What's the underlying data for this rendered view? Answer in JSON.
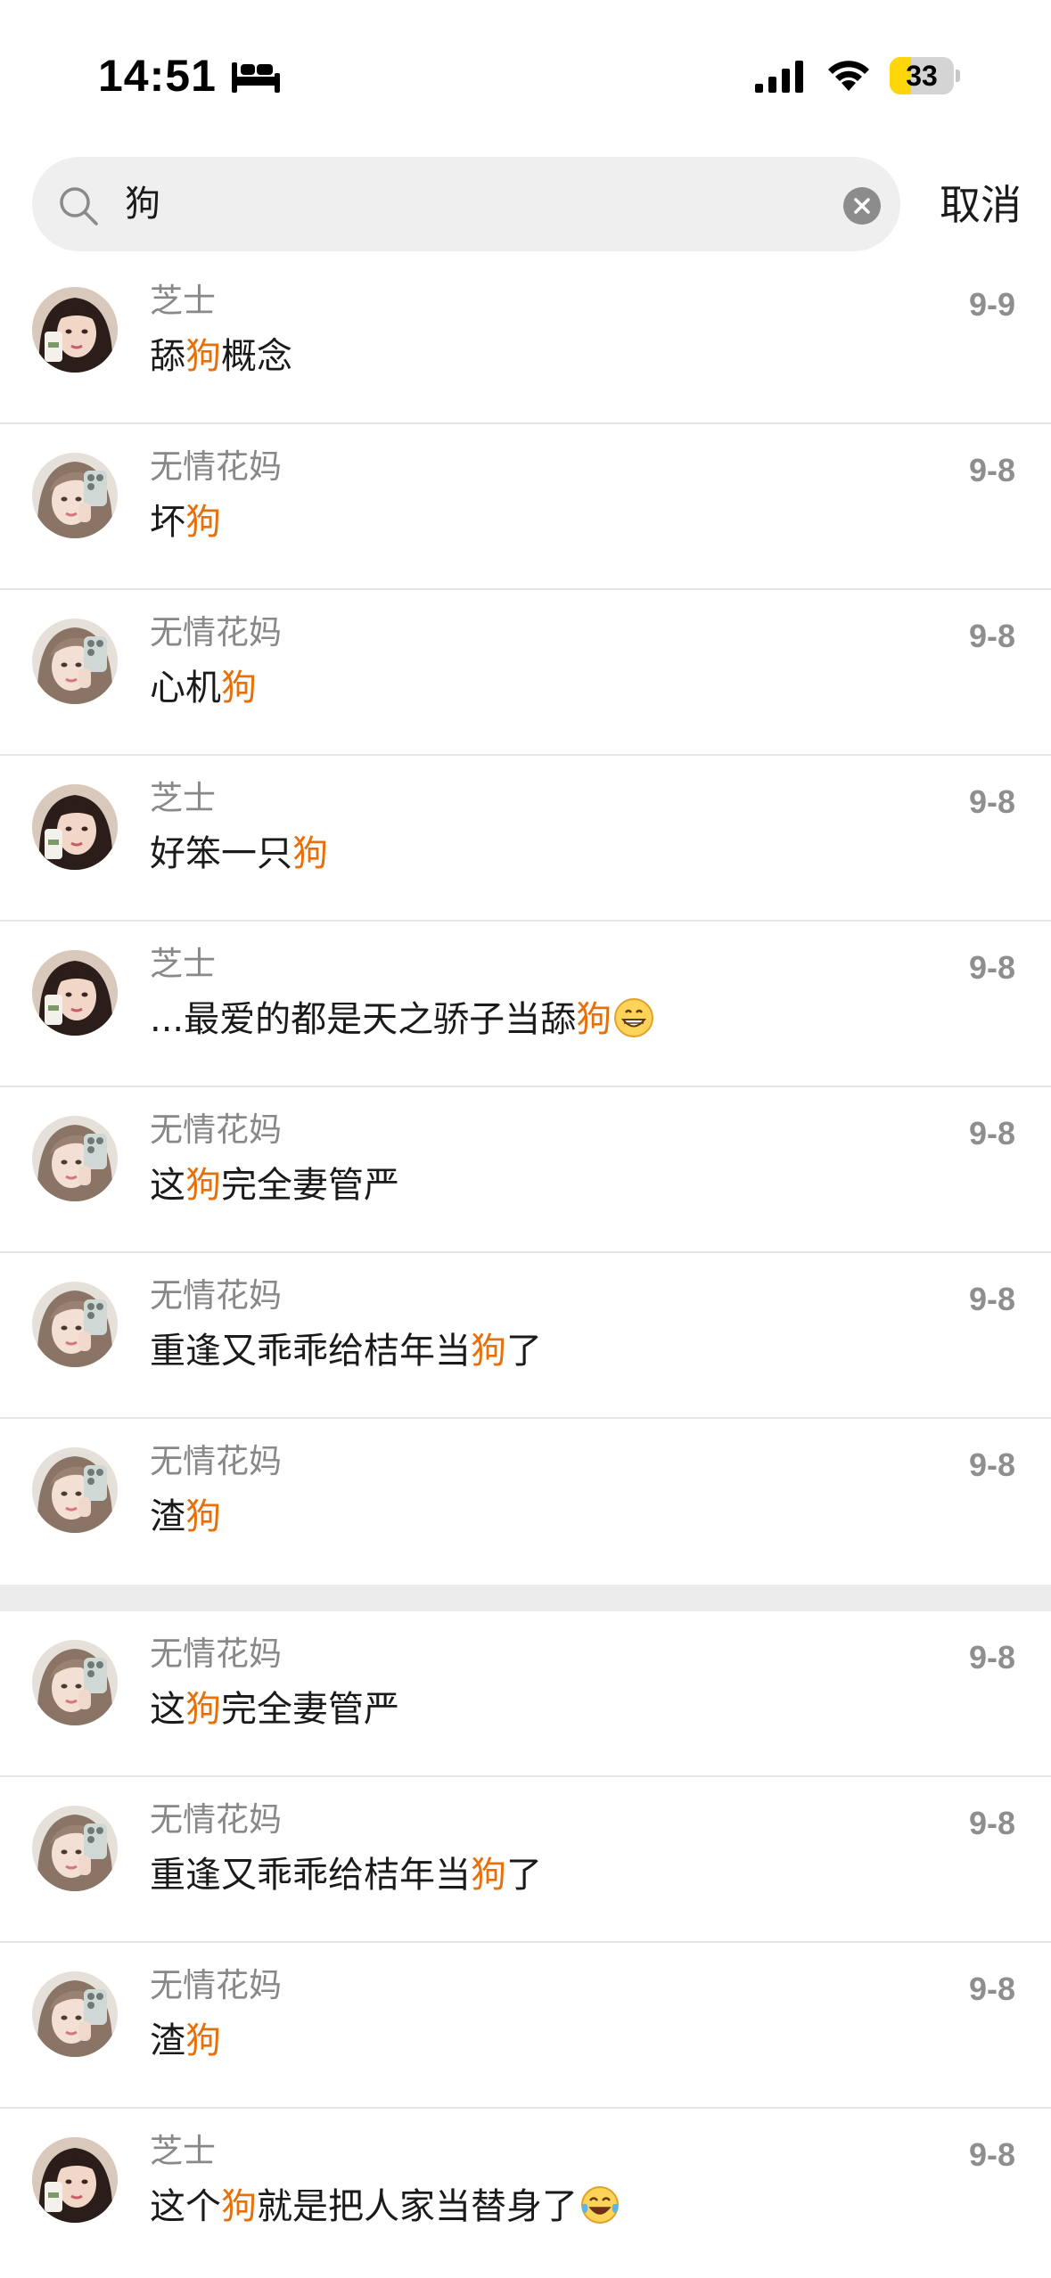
{
  "status_bar": {
    "time": "14:51",
    "sleep_icon": "bed-icon",
    "battery_level": "33",
    "battery_fraction": 0.33,
    "battery_color": "#ffd60a"
  },
  "search": {
    "query": "狗",
    "cancel_label": "取消"
  },
  "highlight_color": "#e8700a",
  "groups": [
    {
      "rows": [
        {
          "avatar": "avatar-zhishi",
          "name": "芝士",
          "date": "9-9",
          "segments": [
            {
              "t": "舔"
            },
            {
              "t": "狗",
              "hl": true
            },
            {
              "t": "概念"
            }
          ]
        },
        {
          "avatar": "avatar-wuqing",
          "name": "无情花妈",
          "date": "9-8",
          "segments": [
            {
              "t": "坏"
            },
            {
              "t": "狗",
              "hl": true
            }
          ]
        },
        {
          "avatar": "avatar-wuqing",
          "name": "无情花妈",
          "date": "9-8",
          "segments": [
            {
              "t": "心机"
            },
            {
              "t": "狗",
              "hl": true
            }
          ]
        },
        {
          "avatar": "avatar-zhishi",
          "name": "芝士",
          "date": "9-8",
          "segments": [
            {
              "t": "好笨一只"
            },
            {
              "t": "狗",
              "hl": true
            }
          ]
        },
        {
          "avatar": "avatar-zhishi",
          "name": "芝士",
          "date": "9-8",
          "segments": [
            {
              "t": "...最爱的都是天之骄子当舔"
            },
            {
              "t": "狗",
              "hl": true
            }
          ],
          "emoji": "grin-emoji"
        },
        {
          "avatar": "avatar-wuqing",
          "name": "无情花妈",
          "date": "9-8",
          "segments": [
            {
              "t": "这"
            },
            {
              "t": "狗",
              "hl": true
            },
            {
              "t": "完全妻管严"
            }
          ]
        },
        {
          "avatar": "avatar-wuqing",
          "name": "无情花妈",
          "date": "9-8",
          "segments": [
            {
              "t": "重逢又乖乖给桔年当"
            },
            {
              "t": "狗",
              "hl": true
            },
            {
              "t": "了"
            }
          ]
        },
        {
          "avatar": "avatar-wuqing",
          "name": "无情花妈",
          "date": "9-8",
          "segments": [
            {
              "t": "渣"
            },
            {
              "t": "狗",
              "hl": true
            }
          ]
        }
      ]
    },
    {
      "rows": [
        {
          "avatar": "avatar-wuqing",
          "name": "无情花妈",
          "date": "9-8",
          "segments": [
            {
              "t": "这"
            },
            {
              "t": "狗",
              "hl": true
            },
            {
              "t": "完全妻管严"
            }
          ]
        },
        {
          "avatar": "avatar-wuqing",
          "name": "无情花妈",
          "date": "9-8",
          "segments": [
            {
              "t": "重逢又乖乖给桔年当"
            },
            {
              "t": "狗",
              "hl": true
            },
            {
              "t": "了"
            }
          ]
        },
        {
          "avatar": "avatar-wuqing",
          "name": "无情花妈",
          "date": "9-8",
          "segments": [
            {
              "t": "渣"
            },
            {
              "t": "狗",
              "hl": true
            }
          ]
        },
        {
          "avatar": "avatar-zhishi",
          "name": "芝士",
          "date": "9-8",
          "segments": [
            {
              "t": "这个"
            },
            {
              "t": "狗",
              "hl": true
            },
            {
              "t": "就是把人家当替身了"
            }
          ],
          "emoji": "tears-of-joy-emoji"
        }
      ]
    }
  ]
}
